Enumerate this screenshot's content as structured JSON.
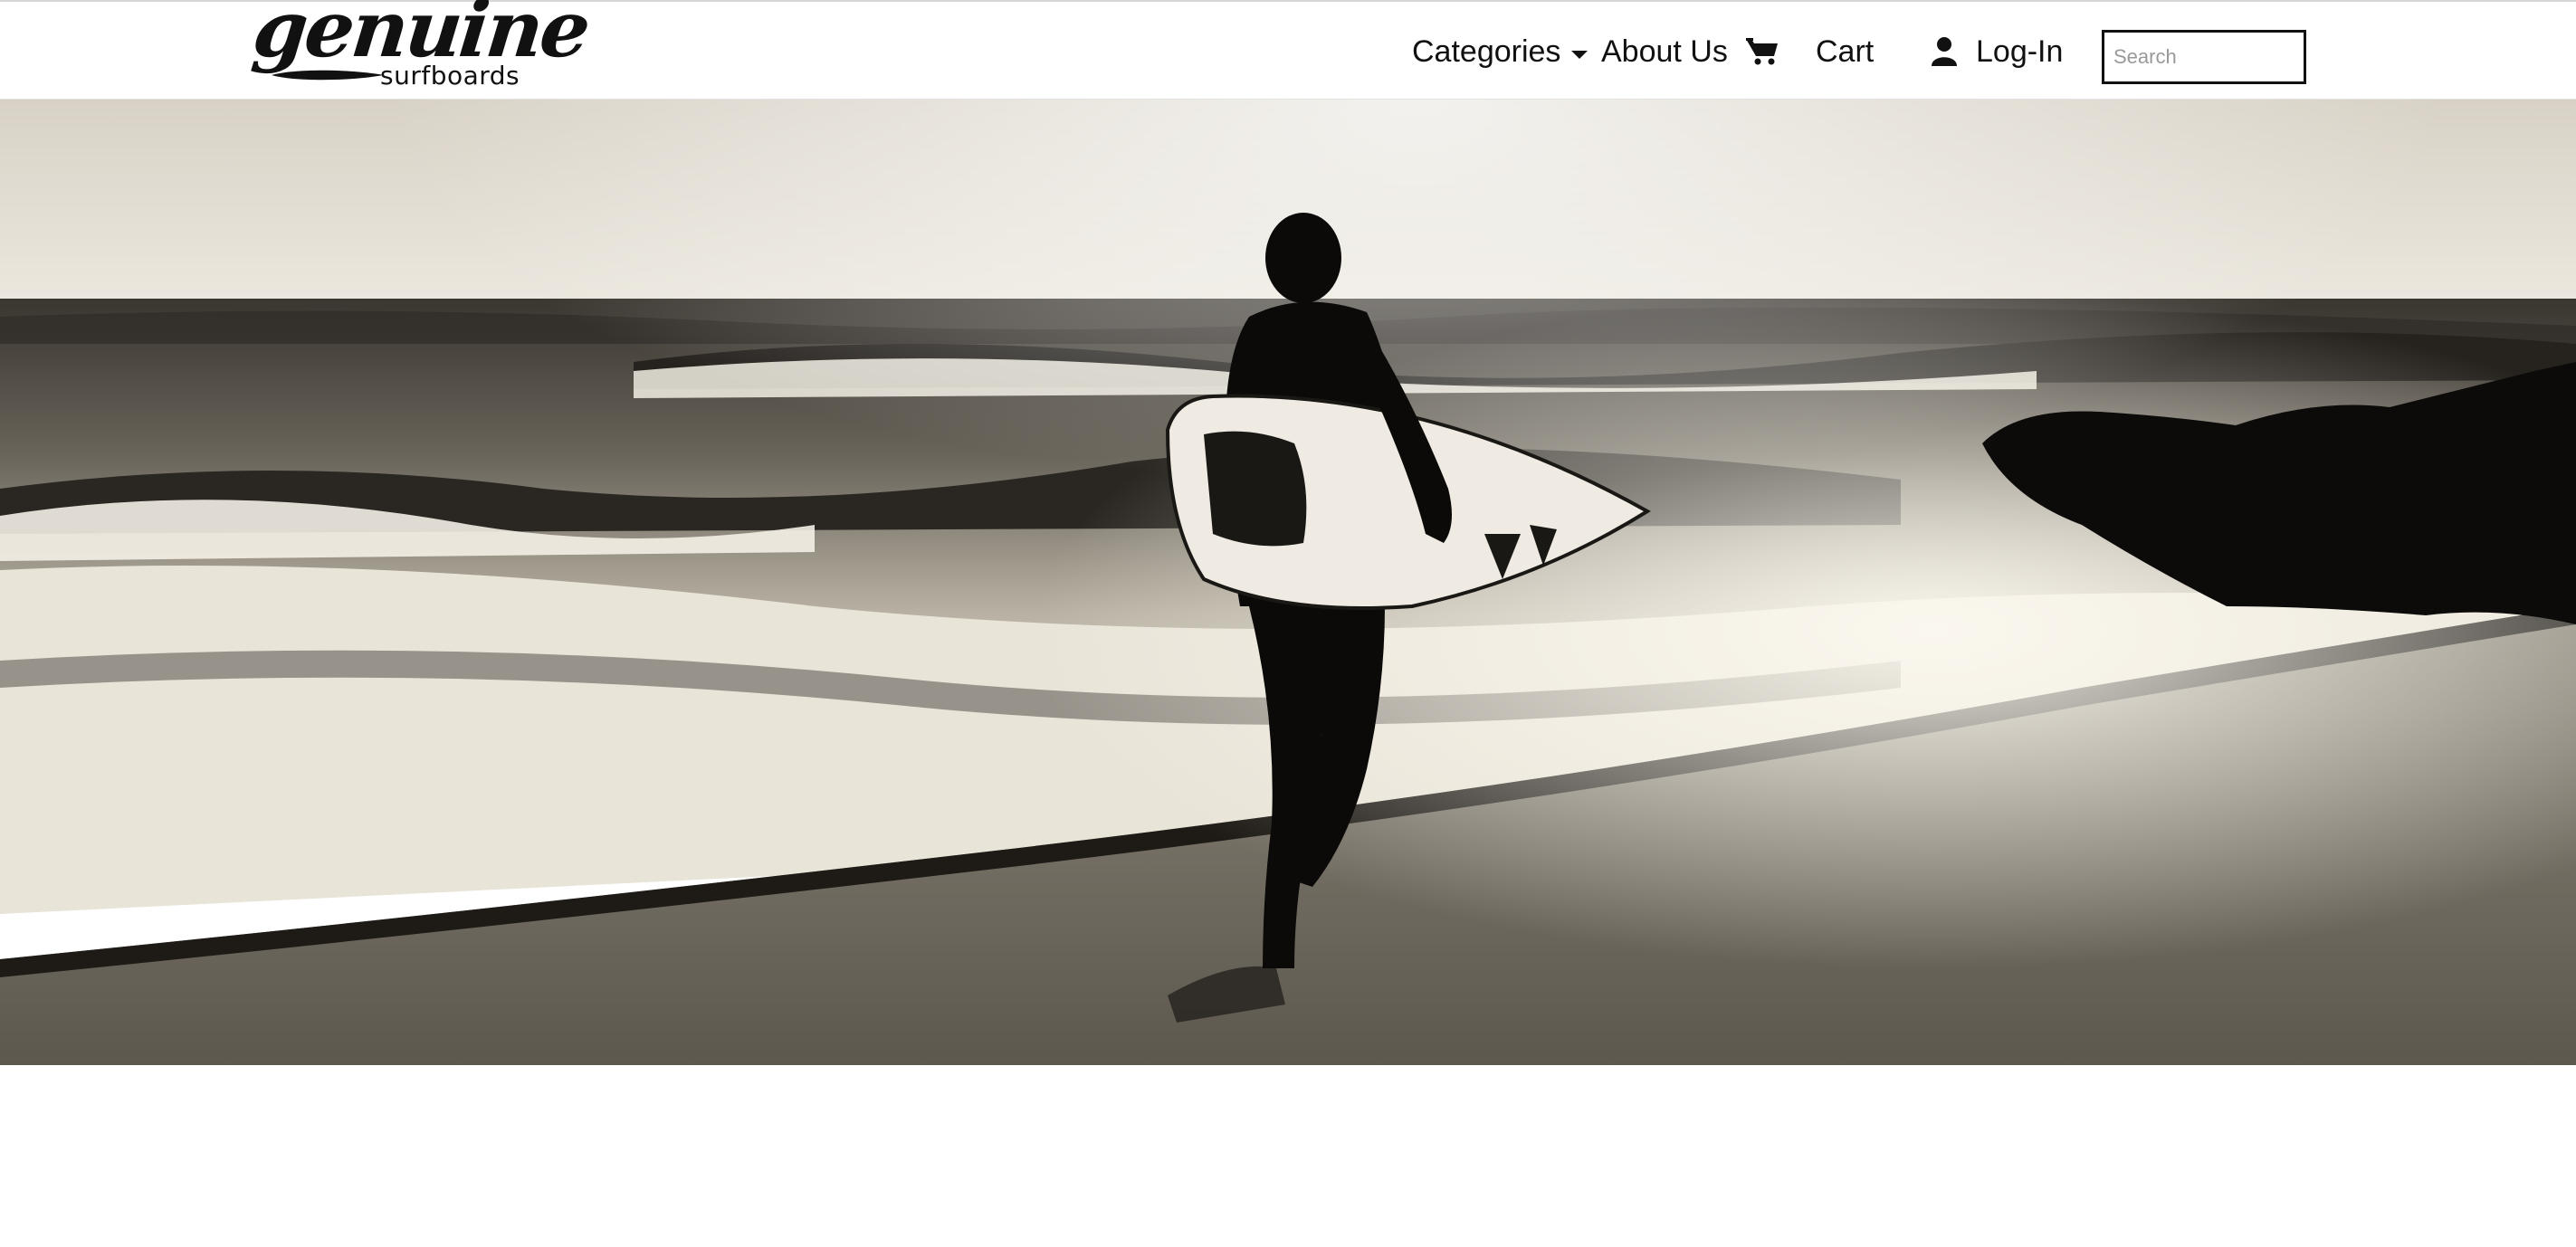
{
  "brand": {
    "logo_main": "genuine",
    "logo_sub": "surfboards"
  },
  "nav": {
    "categories_label": "Categories",
    "about_label": "About Us",
    "cart_label": "Cart",
    "login_label": "Log-In"
  },
  "search": {
    "placeholder": "Search",
    "value": ""
  },
  "icons": {
    "categories": "chevron-down-icon",
    "cart": "shopping-cart-icon",
    "login": "user-icon"
  },
  "colors": {
    "header_bg": "#ffffff",
    "text": "#111111",
    "hero_tone": "sepia-monochrome"
  }
}
